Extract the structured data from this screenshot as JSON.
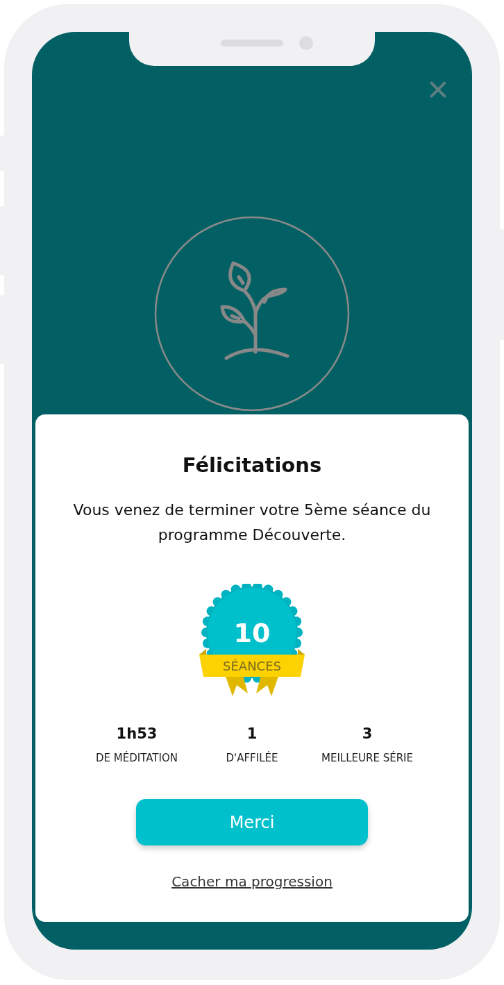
{
  "title": "Félicitations",
  "message": "Vous venez de terminer votre 5ème séance du programme Découverte.",
  "badge": {
    "count": "10",
    "label": "SÉANCES"
  },
  "stats": [
    {
      "value": "1h53",
      "label": "DE MÉDITATION"
    },
    {
      "value": "1",
      "label": "D'AFFILÉE"
    },
    {
      "value": "3",
      "label": "MEILLEURE SÉRIE"
    }
  ],
  "primary_button": "Merci",
  "link": "Cacher ma progression"
}
